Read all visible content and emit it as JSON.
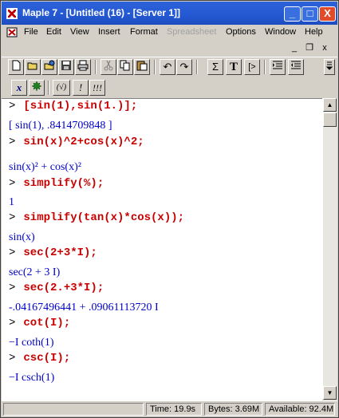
{
  "window": {
    "title": "Maple 7  - [Untitled (16) - [Server 1]]"
  },
  "caption_buttons": {
    "minimize": "_",
    "maximize": "□",
    "close": "X"
  },
  "menu": {
    "items": [
      "File",
      "Edit",
      "View",
      "Insert",
      "Format",
      "Spreadsheet",
      "Options",
      "Window",
      "Help"
    ],
    "mdi": {
      "minimize": "_",
      "restore": "❐",
      "close": "x"
    }
  },
  "toolbar": {
    "sigma": "Σ",
    "text": "T",
    "exec": "[>",
    "undo": "↶",
    "redo": "↷",
    "math_x": "x",
    "sqrt": "(√)",
    "bang": "!",
    "bangs": "!!!"
  },
  "worksheet": [
    {
      "kind": "input",
      "prompt": ">",
      "text": "[sin(1),sin(1.)];"
    },
    {
      "kind": "output",
      "text": "[ sin(1), .8414709848 ]"
    },
    {
      "kind": "input",
      "prompt": ">",
      "text": "sin(x)^2+cos(x)^2;"
    },
    {
      "kind": "output",
      "text": "sin(x)² + cos(x)²"
    },
    {
      "kind": "input",
      "prompt": ">",
      "text": "simplify(%);"
    },
    {
      "kind": "output",
      "text": "1"
    },
    {
      "kind": "input",
      "prompt": ">",
      "text": "simplify(tan(x)*cos(x));"
    },
    {
      "kind": "output",
      "text": "sin(x)"
    },
    {
      "kind": "input",
      "prompt": ">",
      "text": "sec(2+3*I);"
    },
    {
      "kind": "output",
      "text": "sec(2 + 3 I)"
    },
    {
      "kind": "input",
      "prompt": ">",
      "text": "sec(2.+3*I);"
    },
    {
      "kind": "output",
      "text": "-.04167496441 + .09061113720 I"
    },
    {
      "kind": "input",
      "prompt": ">",
      "text": "cot(I);"
    },
    {
      "kind": "output",
      "text": "−I coth(1)"
    },
    {
      "kind": "input",
      "prompt": ">",
      "text": "csc(I);"
    },
    {
      "kind": "output",
      "text": "−I csch(1)"
    }
  ],
  "status": {
    "time": "Time: 19.9s",
    "bytes": "Bytes: 3.69M",
    "available": "Available: 92.4M"
  }
}
